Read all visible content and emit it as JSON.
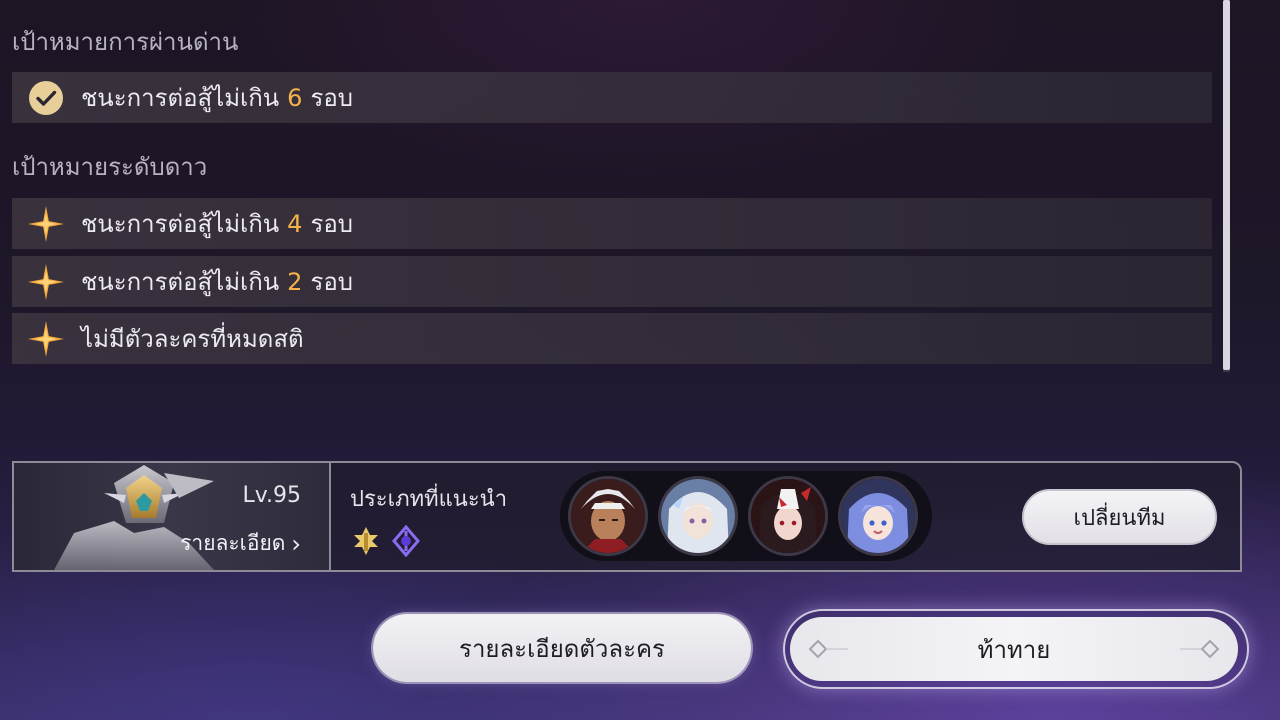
{
  "clear_goals": {
    "title": "เป้าหมายการผ่านด่าน",
    "items": [
      {
        "icon": "check-circle-icon",
        "prefix": "ชนะการต่อสู้ไม่เกิน",
        "number": "6",
        "suffix": "รอบ"
      }
    ]
  },
  "star_goals": {
    "title": "เป้าหมายระดับดาว",
    "items": [
      {
        "icon": "star-icon",
        "prefix": "ชนะการต่อสู้ไม่เกิน",
        "number": "4",
        "suffix": "รอบ"
      },
      {
        "icon": "star-icon",
        "prefix": "ชนะการต่อสู้ไม่เกิน",
        "number": "2",
        "suffix": "รอบ"
      },
      {
        "icon": "star-icon",
        "text": "ไม่มีตัวละครที่หมดสติ"
      }
    ]
  },
  "enemy": {
    "level": "Lv.95",
    "details_label": "รายละเอียด",
    "details_chevron": "›"
  },
  "team": {
    "recommended_label": "ประเภทที่แนะนำ",
    "recommended_paths": [
      "preservation-path-icon",
      "nihility-path-icon"
    ],
    "members": [
      "character-avatar-1",
      "character-avatar-2",
      "character-avatar-3",
      "character-avatar-4"
    ],
    "swap_label": "เปลี่ยนทีม"
  },
  "actions": {
    "character_details_label": "รายละเอียดตัวละคร",
    "challenge_label": "ท้าทาย"
  },
  "colors": {
    "accent_number": "#f3b24a",
    "star": "#f4a93a",
    "check_badge": "#e8cf9a"
  }
}
